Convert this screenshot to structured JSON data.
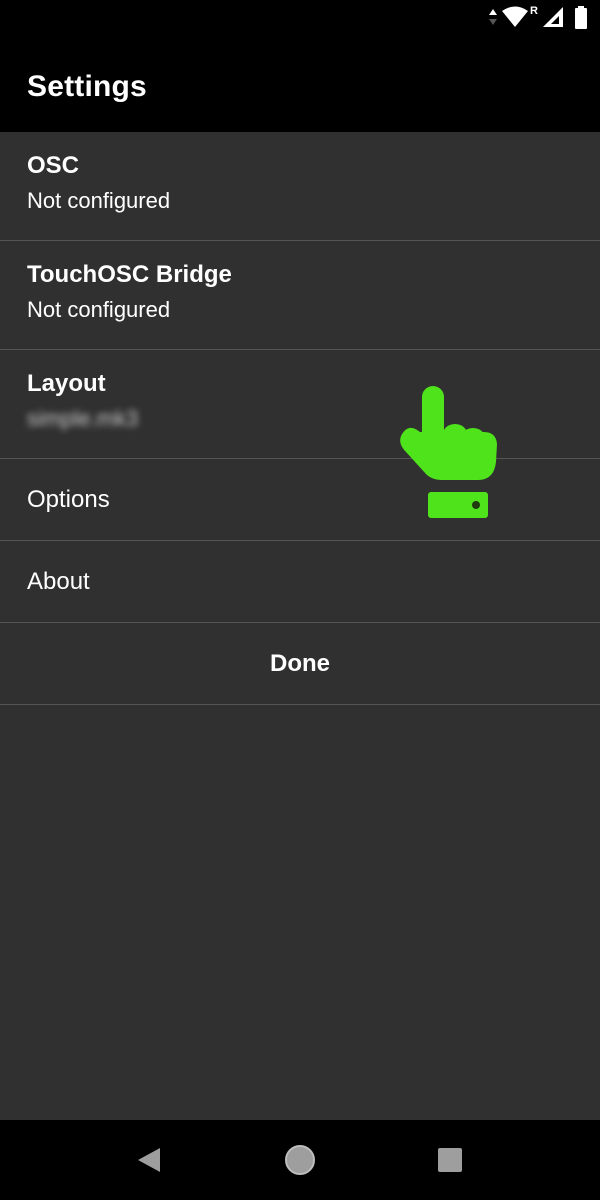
{
  "status_bar": {
    "icons": [
      "data-arrows-icon",
      "wifi-icon",
      "roaming-indicator",
      "cell-signal-icon",
      "battery-icon"
    ],
    "roaming_label": "R"
  },
  "app_bar": {
    "title": "Settings"
  },
  "settings": {
    "items": [
      {
        "title": "OSC",
        "subtitle": "Not configured"
      },
      {
        "title": "TouchOSC Bridge",
        "subtitle": "Not configured"
      },
      {
        "title": "Layout",
        "subtitle": "simple.mk3"
      },
      {
        "label": "Options"
      },
      {
        "label": "About"
      }
    ],
    "done_label": "Done"
  },
  "overlay": {
    "icon": "pointing-hand-icon",
    "color": "#4fe31b"
  },
  "nav_bar": {
    "buttons": [
      "back-icon",
      "home-icon",
      "recents-icon"
    ],
    "icon_color": "#9e9e9e"
  }
}
